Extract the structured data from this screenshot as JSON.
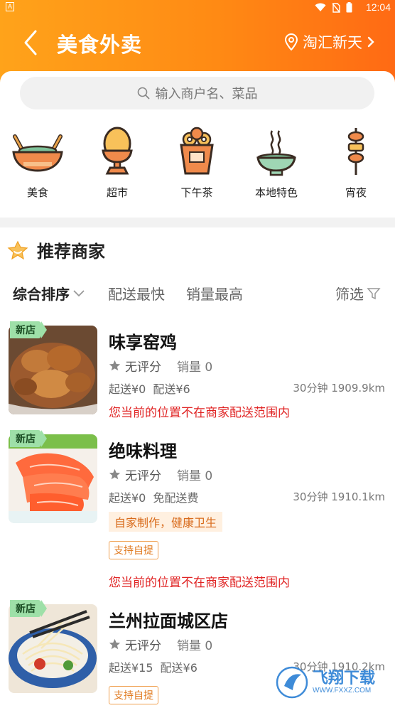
{
  "status": {
    "indicator": "A",
    "time": "12:04"
  },
  "header": {
    "title": "美食外卖",
    "location": "淘汇新天"
  },
  "search": {
    "placeholder": "输入商户名、菜品"
  },
  "categories": [
    {
      "label": "美食",
      "icon": "salad-bowl-icon"
    },
    {
      "label": "超市",
      "icon": "egg-cup-icon"
    },
    {
      "label": "下午茶",
      "icon": "donut-box-icon"
    },
    {
      "label": "本地特色",
      "icon": "steaming-bowl-icon"
    },
    {
      "label": "宵夜",
      "icon": "skewer-icon"
    }
  ],
  "section": {
    "title": "推荐商家"
  },
  "sort": {
    "default": "综合排序",
    "fastest": "配送最快",
    "sales": "销量最高",
    "filter": "筛选"
  },
  "shops": [
    {
      "badge": "新店",
      "name": "味享窑鸡",
      "rating": "无评分",
      "sales": "销量 0",
      "min_order": "起送¥0",
      "delivery": "配送¥6",
      "distance": "30分钟 1909.9km",
      "warning": "您当前的位置不在商家配送范围内"
    },
    {
      "badge": "新店",
      "name": "绝味料理",
      "rating": "无评分",
      "sales": "销量 0",
      "min_order": "起送¥0",
      "delivery": "免配送费",
      "distance": "30分钟 1910.1km",
      "tag": "自家制作，健康卫生",
      "pickup": "支持自提",
      "warning": "您当前的位置不在商家配送范围内"
    },
    {
      "badge": "新店",
      "name": "兰州拉面城区店",
      "rating": "无评分",
      "sales": "销量 0",
      "min_order": "起送¥15",
      "delivery": "配送¥6",
      "distance": "30分钟 1910.2km",
      "pickup": "支持自提"
    }
  ],
  "watermark": {
    "text": "飞翔下载",
    "url": "WWW.FXXZ.COM"
  },
  "colors": {
    "header_start": "#ffa31a",
    "header_end": "#ff6a14",
    "accent": "#ff8a14",
    "warning": "#e02323",
    "badge": "#9ee0a8"
  }
}
